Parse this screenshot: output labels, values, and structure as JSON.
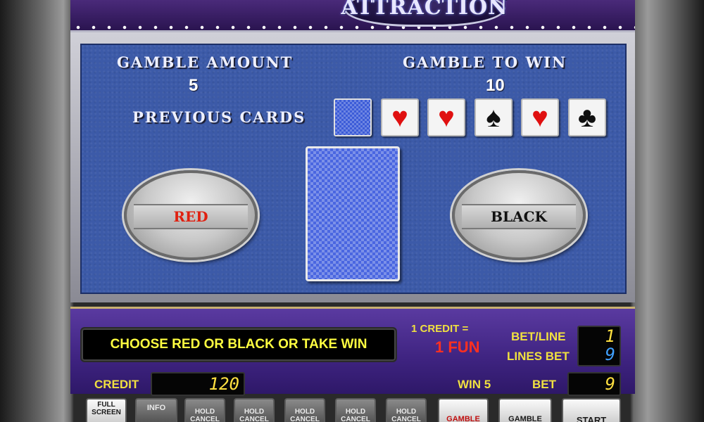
{
  "banner": {
    "title": "ATTRACTION"
  },
  "gamble": {
    "amount_label": "GAMBLE AMOUNT",
    "amount_value": "5",
    "to_win_label": "GAMBLE TO WIN",
    "to_win_value": "10",
    "previous_cards_label": "PREVIOUS CARDS",
    "previous_cards": [
      {
        "type": "back",
        "symbol": ""
      },
      {
        "type": "heart",
        "symbol": "♥"
      },
      {
        "type": "heart",
        "symbol": "♥"
      },
      {
        "type": "spade",
        "symbol": "♠"
      },
      {
        "type": "heart",
        "symbol": "♥"
      },
      {
        "type": "club",
        "symbol": "♣"
      }
    ],
    "red_label": "RED",
    "black_label": "BLACK"
  },
  "console": {
    "message": "CHOOSE RED OR BLACK OR TAKE WIN",
    "credit_rate": "1 CREDIT =",
    "credit_value": "1 FUN",
    "bet_line_label": "BET/LINE",
    "bet_line_value": "1",
    "lines_bet_label": "LINES BET",
    "lines_bet_value": "9",
    "credit_label": "CREDIT",
    "credit_amount": "120",
    "win_label": "WIN 5",
    "bet_label": "BET",
    "bet_value": "9"
  },
  "buttons": {
    "full_screen_1": "FULL",
    "full_screen_2": "SCREEN",
    "info": "INFO",
    "hold": "HOLD",
    "cancel": "CANCEL",
    "gamble_red": "GAMBLE",
    "gamble_black": "GAMBLE",
    "start": "START"
  },
  "colors": {
    "panel_blue": "#3c5aa8",
    "console_purple": "#3e2380",
    "message_yellow": "#ffff40",
    "fun_red": "#ff3020",
    "red_button_text": "#e02010"
  }
}
